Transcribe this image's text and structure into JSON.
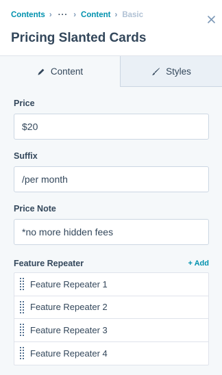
{
  "breadcrumb": {
    "items": [
      "Contents",
      "Content",
      "Basic"
    ],
    "ellipsis": "···",
    "separator": "›"
  },
  "header": {
    "title": "Pricing Slanted Cards"
  },
  "tabs": [
    {
      "label": "Content",
      "icon": "pencil-icon",
      "active": true
    },
    {
      "label": "Styles",
      "icon": "brush-icon",
      "active": false
    }
  ],
  "fields": {
    "price": {
      "label": "Price",
      "value": "$20"
    },
    "suffix": {
      "label": "Suffix",
      "value": "/per month"
    },
    "price_note": {
      "label": "Price Note",
      "value": "*no more hidden fees"
    }
  },
  "repeater": {
    "title": "Feature Repeater",
    "add_label": "+ Add",
    "items": [
      "Feature Repeater 1",
      "Feature Repeater 2",
      "Feature Repeater 3",
      "Feature Repeater 4"
    ]
  },
  "colors": {
    "accent": "#0091ae",
    "text": "#33475b",
    "border": "#cbd6e2",
    "panel_bg": "#f5f8fa"
  }
}
